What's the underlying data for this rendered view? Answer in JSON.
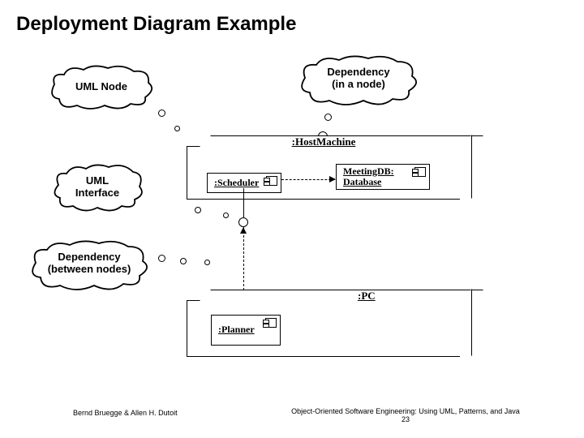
{
  "title": "Deployment Diagram Example",
  "callouts": {
    "uml_node": "UML Node",
    "dependency_in_node": {
      "line1": "Dependency",
      "line2": "(in a node)"
    },
    "uml_interface": {
      "line1": "UML",
      "line2": "Interface"
    },
    "dependency_between": {
      "line1": "Dependency",
      "line2": "(between nodes)"
    }
  },
  "nodes": {
    "host": ":HostMachine",
    "pc": ":PC"
  },
  "components": {
    "scheduler": ":Scheduler",
    "planner": ":Planner",
    "meetingdb": {
      "line1": "MeetingDB:",
      "line2": "Database"
    }
  },
  "footer": {
    "authors": "Bernd Bruegge & Allen H. Dutoit",
    "book": "Object-Oriented Software Engineering: Using UML, Patterns, and Java",
    "page": "23"
  }
}
